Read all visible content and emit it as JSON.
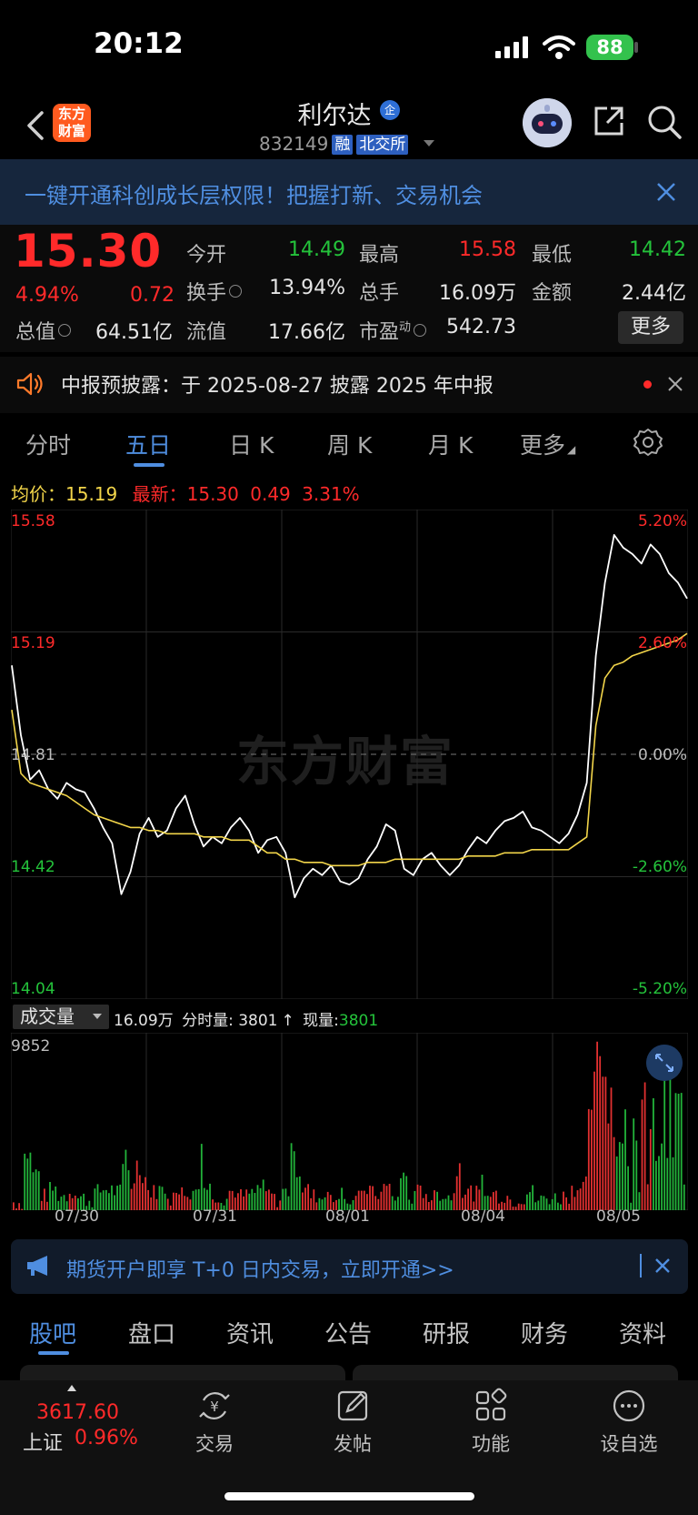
{
  "status_bar": {
    "time": "20:12",
    "battery": "88"
  },
  "header": {
    "brand_logo": "东方财富",
    "stock_name": "利尔达",
    "corp_badge": "企",
    "stock_code": "832149",
    "tag_margin": "融",
    "tag_exchange": "北交所"
  },
  "promo": {
    "text": "一键开通科创成长层权限！把握打新、交易机会"
  },
  "quote": {
    "price": "15.30",
    "change_pct": "4.94%",
    "change_amt": "0.72",
    "fields": [
      {
        "label": "今开",
        "value": "14.49",
        "color": "green"
      },
      {
        "label": "最高",
        "value": "15.58",
        "color": "red"
      },
      {
        "label": "最低",
        "value": "14.42",
        "color": "green"
      },
      {
        "label": "换手",
        "value": "13.94%",
        "color": "white"
      },
      {
        "label": "总手",
        "value": "16.09万",
        "color": "white"
      },
      {
        "label": "金额",
        "value": "2.44亿",
        "color": "white"
      },
      {
        "label": "总值",
        "value": "64.51亿",
        "color": "white"
      },
      {
        "label": "流值",
        "value": "17.66亿",
        "color": "white"
      },
      {
        "label": "市盈",
        "label_sup": "动",
        "value": "542.73",
        "color": "white"
      }
    ],
    "more_label": "更多"
  },
  "notice": {
    "text": "中报预披露：于 2025-08-27 披露 2025 年中报"
  },
  "tabs": [
    "分时",
    "五日",
    "日 K",
    "周 K",
    "月 K",
    "更多"
  ],
  "active_tab": "五日",
  "chart_header": {
    "avg_label": "均价：",
    "avg_value": "15.19",
    "latest_label": "最新：",
    "latest_value": "15.30",
    "latest_chg": "0.49",
    "latest_pct": "3.31%"
  },
  "chart_data": {
    "type": "line",
    "left_axis": [
      "15.58",
      "15.19",
      "14.81",
      "14.42",
      "14.04"
    ],
    "right_axis": [
      "5.20%",
      "2.60%",
      "0.00%",
      "-2.60%",
      "-5.20%"
    ],
    "ylim": [
      14.04,
      15.58
    ],
    "reference_price": 14.81,
    "days": [
      "07/30",
      "07/31",
      "08/01",
      "08/04",
      "08/05"
    ],
    "series": [
      {
        "name": "最新",
        "color": "#ffffff",
        "values": [
          15.09,
          14.87,
          14.73,
          14.76,
          14.7,
          14.67,
          14.72,
          14.7,
          14.69,
          14.64,
          14.58,
          14.53,
          14.37,
          14.44,
          14.56,
          14.61,
          14.55,
          14.57,
          14.64,
          14.68,
          14.59,
          14.52,
          14.55,
          14.53,
          14.58,
          14.61,
          14.57,
          14.5,
          14.54,
          14.55,
          14.5,
          14.36,
          14.42,
          14.45,
          14.43,
          14.46,
          14.41,
          14.4,
          14.42,
          14.48,
          14.52,
          14.59,
          14.57,
          14.45,
          14.43,
          14.48,
          14.5,
          14.46,
          14.43,
          14.46,
          14.51,
          14.55,
          14.53,
          14.57,
          14.6,
          14.61,
          14.63,
          14.58,
          14.57,
          14.55,
          14.53,
          14.56,
          14.62,
          14.72,
          15.12,
          15.35,
          15.5,
          15.46,
          15.44,
          15.41,
          15.47,
          15.44,
          15.38,
          15.35,
          15.3
        ]
      },
      {
        "name": "均价",
        "color": "#f2d54a",
        "values": [
          14.95,
          14.75,
          14.72,
          14.71,
          14.7,
          14.69,
          14.68,
          14.66,
          14.64,
          14.62,
          14.61,
          14.6,
          14.59,
          14.58,
          14.58,
          14.57,
          14.57,
          14.56,
          14.56,
          14.56,
          14.56,
          14.55,
          14.55,
          14.55,
          14.54,
          14.54,
          14.54,
          14.52,
          14.5,
          14.5,
          14.48,
          14.48,
          14.47,
          14.47,
          14.47,
          14.46,
          14.46,
          14.46,
          14.46,
          14.47,
          14.47,
          14.47,
          14.48,
          14.48,
          14.48,
          14.48,
          14.48,
          14.48,
          14.48,
          14.48,
          14.49,
          14.49,
          14.49,
          14.49,
          14.5,
          14.5,
          14.5,
          14.51,
          14.51,
          14.51,
          14.51,
          14.51,
          14.53,
          14.55,
          14.9,
          15.05,
          15.09,
          15.1,
          15.12,
          15.13,
          15.14,
          15.15,
          15.16,
          15.17,
          15.19
        ]
      }
    ]
  },
  "volume": {
    "selector": "成交量",
    "total": "16.09万",
    "period_label": "分时量:",
    "period_value": "3801",
    "now_label": "现量:",
    "now_value": "3801",
    "max_label": "9852",
    "max": 9852
  },
  "futures_banner": {
    "text": "期货开户即享 T+0 日内交易，立即开通>>"
  },
  "bottom_tabs": [
    "股吧",
    "盘口",
    "资讯",
    "公告",
    "研报",
    "财务",
    "资料"
  ],
  "nav": {
    "index_value": "3617.60",
    "index_name": "上证",
    "index_pct": "0.96%",
    "items": [
      "交易",
      "发帖",
      "功能",
      "设自选"
    ]
  }
}
